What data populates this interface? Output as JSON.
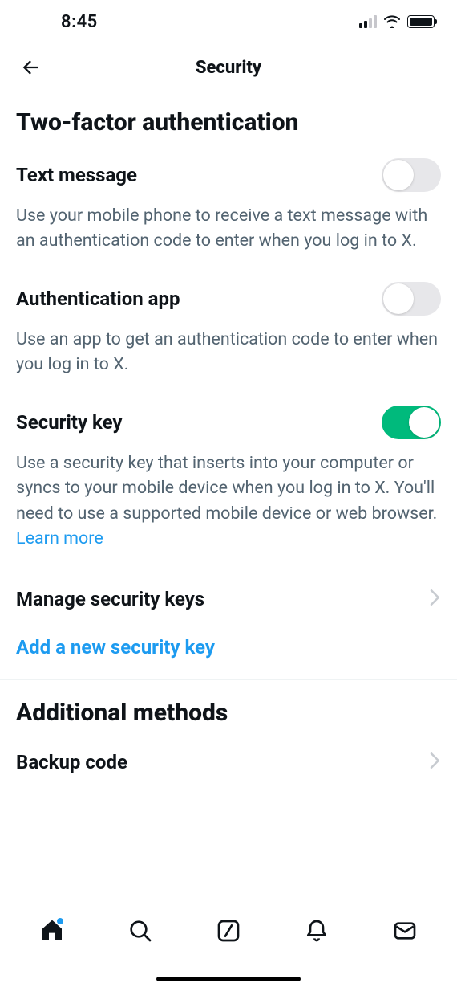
{
  "status": {
    "time": "8:45"
  },
  "header": {
    "title": "Security"
  },
  "section1": {
    "heading": "Two-factor authentication",
    "options": {
      "text_message": {
        "title": "Text message",
        "desc": "Use your mobile phone to receive a text message with an authentication code to enter when you log in to X.",
        "on": false
      },
      "auth_app": {
        "title": "Authentication app",
        "desc": "Use an app to get an authentication code to enter when you log in to X.",
        "on": false
      },
      "security_key": {
        "title": "Security key",
        "desc": "Use a security key that inserts into your computer or syncs to your mobile device when you log in to X. You'll need to use a supported mobile device or web browser. ",
        "learn_more": "Learn more",
        "on": true
      }
    },
    "manage_keys_label": "Manage security keys",
    "add_key_label": "Add a new security key"
  },
  "section2": {
    "heading": "Additional methods",
    "backup_code_label": "Backup code"
  }
}
